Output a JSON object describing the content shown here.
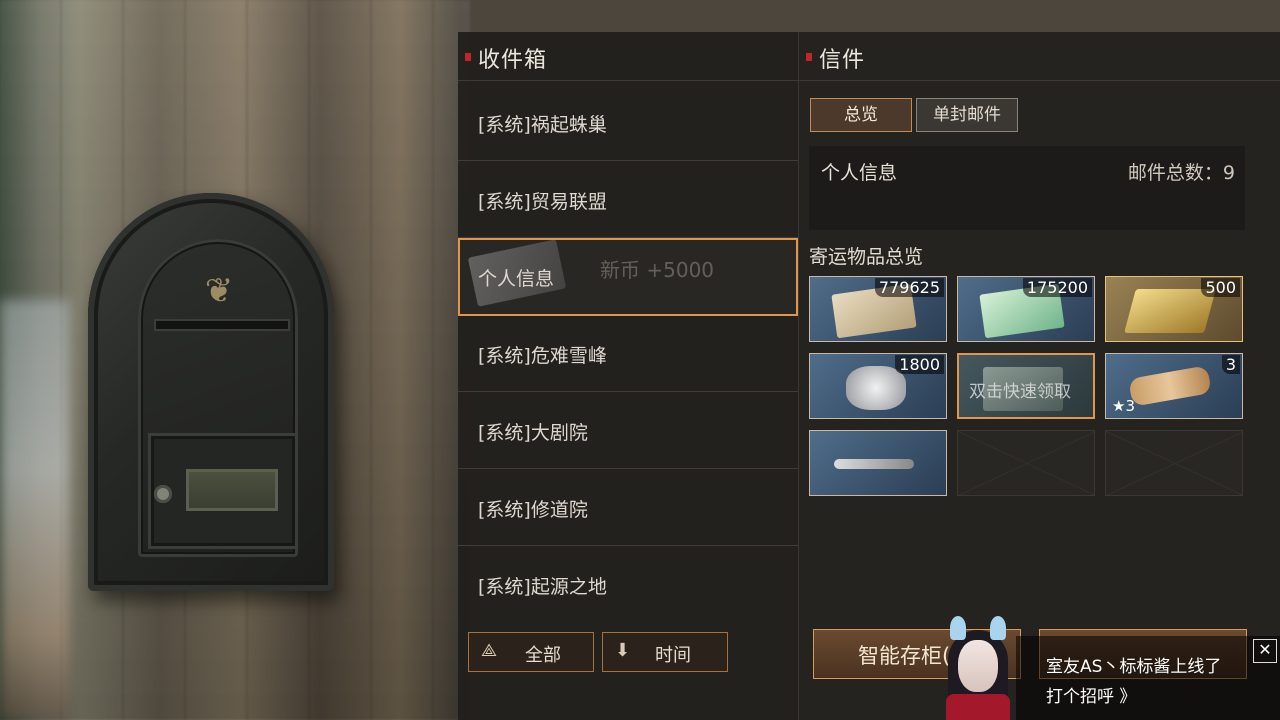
{
  "inbox": {
    "title": "收件箱",
    "items": [
      {
        "label": "[系统]祸起蛛巢"
      },
      {
        "label": "[系统]贸易联盟"
      },
      {
        "label": "个人信息",
        "overlay": "新币 +5000"
      },
      {
        "label": "[系统]危难雪峰"
      },
      {
        "label": "[系统]大剧院"
      },
      {
        "label": "[系统]修道院"
      },
      {
        "label": "[系统]起源之地"
      }
    ],
    "sort_all": "全部",
    "sort_time": "时间"
  },
  "letter": {
    "title": "信件",
    "tab_overview": "总览",
    "tab_single": "单封邮件",
    "sender": "个人信息",
    "total_count_label": "邮件总数：9",
    "shipping_title": "寄运物品总览",
    "items": [
      {
        "qty": "779625",
        "icon": "ticket-icon"
      },
      {
        "qty": "175200",
        "icon": "green-ticket-icon"
      },
      {
        "qty": "500",
        "icon": "gold-bar-icon"
      },
      {
        "qty": "1800",
        "icon": "ore-icon"
      },
      {
        "hint": "双击快速领取",
        "icon": "supply-box-icon"
      },
      {
        "qty": "3",
        "star": "★3",
        "icon": "scroll-icon"
      },
      {
        "icon": "wrench-icon"
      }
    ],
    "smart_store": "智能存柜(",
    "colors": {
      "accent": "#e0964d",
      "title_marker": "#c2232d"
    }
  },
  "notification": {
    "text": "室友AS丶标标酱上线了",
    "link": "打个招呼 》",
    "close": "✕"
  }
}
